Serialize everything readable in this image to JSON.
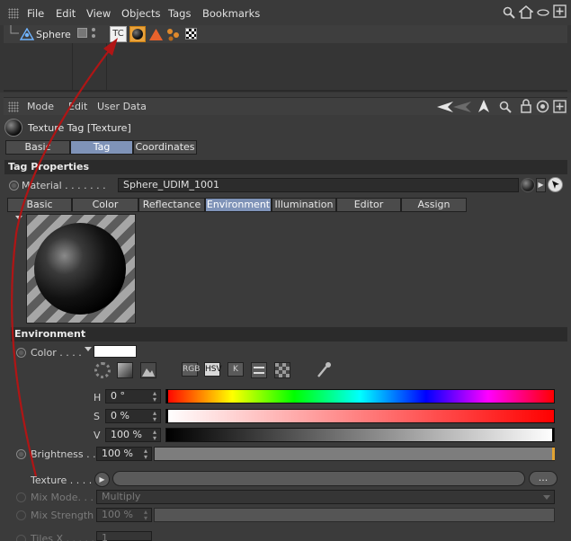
{
  "menubar": {
    "items": [
      "File",
      "Edit",
      "View",
      "Objects",
      "Tags",
      "Bookmarks"
    ]
  },
  "object_manager": {
    "object_name": "Sphere",
    "tag_label": "TC"
  },
  "attribute_manager": {
    "menu": [
      "Mode",
      "Edit",
      "User Data"
    ],
    "title": "Texture Tag [Texture]",
    "top_tabs": [
      {
        "label": "Basic",
        "active": false
      },
      {
        "label": "Tag",
        "active": true
      },
      {
        "label": "Coordinates",
        "active": false
      }
    ],
    "tag_properties_header": "Tag Properties",
    "material_label": "Material . . . . . . .",
    "material_value": "Sphere_UDIM_1001",
    "material_tabs": [
      {
        "label": "Basic",
        "active": false
      },
      {
        "label": "Color",
        "active": false
      },
      {
        "label": "Reflectance",
        "active": false
      },
      {
        "label": "Environment",
        "active": true
      },
      {
        "label": "Illumination",
        "active": false
      },
      {
        "label": "Editor",
        "active": false
      },
      {
        "label": "Assign",
        "active": false
      }
    ],
    "environment_header": "Environment",
    "color_label": "Color . . . .",
    "color_value": "#ffffff",
    "mode_buttons": [
      "RGB",
      "HSV",
      "K"
    ],
    "hsv": [
      {
        "label": "H",
        "value": "0 °"
      },
      {
        "label": "S",
        "value": "0 %"
      },
      {
        "label": "V",
        "value": "100 %"
      }
    ],
    "brightness_label": "Brightness . .",
    "brightness_value": "100 %",
    "brightness_level": 1.0,
    "texture_label": "Texture . . . . .",
    "texture_more": "...",
    "mix_mode_label": "Mix Mode. . .",
    "mix_mode_value": "Multiply",
    "mix_strength_label": "Mix Strength",
    "mix_strength_value": "100 %",
    "tiles_x_label": "Tiles X . . . . .",
    "tiles_x_value": "1"
  },
  "colors": {
    "accent": "#7f93b8",
    "annotation_arrow": "#b01515"
  }
}
